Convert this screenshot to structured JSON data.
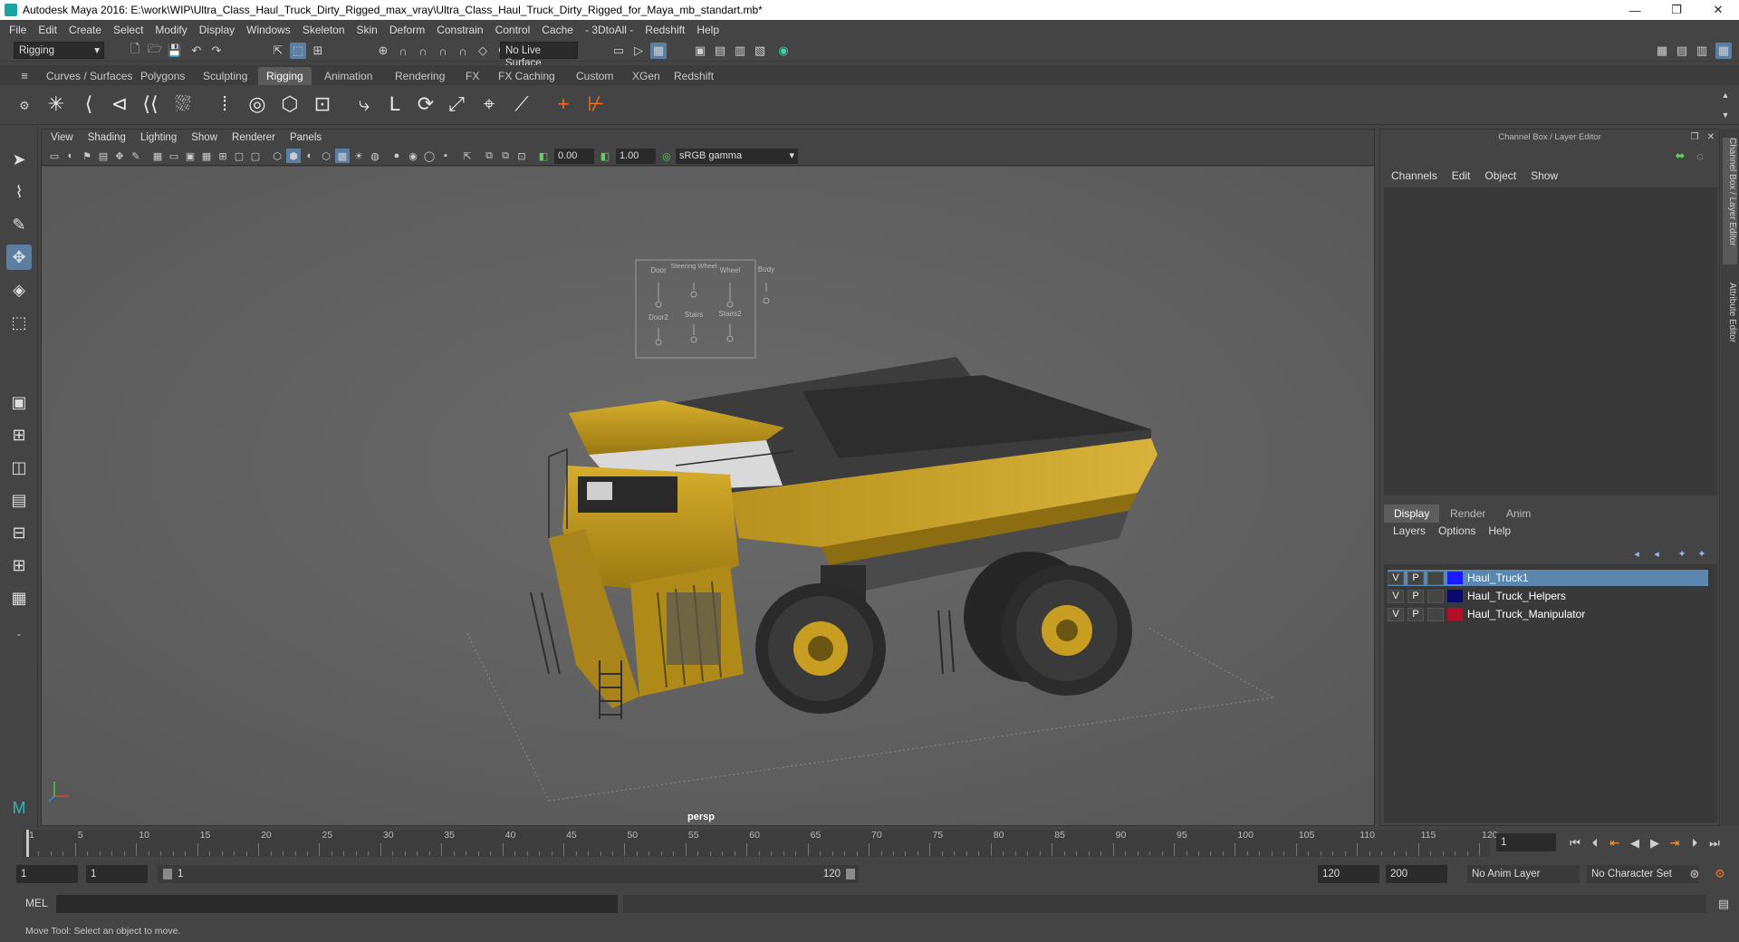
{
  "window": {
    "title": "Autodesk Maya 2016: E:\\work\\WIP\\Ultra_Class_Haul_Truck_Dirty_Rigged_max_vray\\Ultra_Class_Haul_Truck_Dirty_Rigged_for_Maya_mb_standart.mb*"
  },
  "menubar": [
    "File",
    "Edit",
    "Create",
    "Select",
    "Modify",
    "Display",
    "Windows",
    "Skeleton",
    "Skin",
    "Deform",
    "Constrain",
    "Control",
    "Cache",
    "- 3DtoAll -",
    "Redshift",
    "Help"
  ],
  "toolbar": {
    "mode": "Rigging",
    "live_surface": "No Live Surface"
  },
  "shelf_tabs": [
    "Curves / Surfaces",
    "Polygons",
    "Sculpting",
    "Rigging",
    "Animation",
    "Rendering",
    "FX",
    "FX Caching",
    "Custom",
    "XGen",
    "Redshift"
  ],
  "shelf_active": "Rigging",
  "viewport": {
    "menu": [
      "View",
      "Shading",
      "Lighting",
      "Show",
      "Renderer",
      "Panels"
    ],
    "exposure": "0.00",
    "gamma": "1.00",
    "color_space": "sRGB gamma",
    "camera_label": "persp",
    "rig_panel": {
      "labels_top": [
        "Door",
        "Steering Wheel",
        "Wheel",
        "Body"
      ],
      "labels_bottom": [
        "Door2",
        "Stairs",
        "Stairs2"
      ]
    }
  },
  "channel_box": {
    "title": "Channel Box / Layer Editor",
    "menu": [
      "Channels",
      "Edit",
      "Object",
      "Show"
    ]
  },
  "layer_editor": {
    "tabs": [
      "Display",
      "Render",
      "Anim"
    ],
    "active_tab": "Display",
    "menu": [
      "Layers",
      "Options",
      "Help"
    ],
    "layers": [
      {
        "v": "V",
        "p": "P",
        "name": "Haul_Truck1",
        "color": "#1a1aff",
        "selected": true
      },
      {
        "v": "V",
        "p": "P",
        "name": "Haul_Truck_Helpers",
        "color": "#0a0a6e",
        "selected": false
      },
      {
        "v": "V",
        "p": "P",
        "name": "Haul_Truck_Manipulator",
        "color": "#b0102a",
        "selected": false
      }
    ]
  },
  "side_tabs": [
    "Channel Box / Layer Editor",
    "Attribute Editor"
  ],
  "timeline": {
    "ticks": [
      1,
      5,
      10,
      15,
      20,
      25,
      30,
      35,
      40,
      45,
      50,
      55,
      60,
      65,
      70,
      75,
      80,
      85,
      90,
      95,
      100,
      105,
      110,
      115,
      120
    ],
    "current_frame": "1"
  },
  "range": {
    "start": "1",
    "start2": "1",
    "slider_start": "1",
    "slider_end": "120",
    "end": "120",
    "end2": "200",
    "anim_layer": "No Anim Layer",
    "char_set": "No Character Set"
  },
  "command_line": {
    "label": "MEL"
  },
  "status": {
    "help_text": "Move Tool: Select an object to move."
  }
}
